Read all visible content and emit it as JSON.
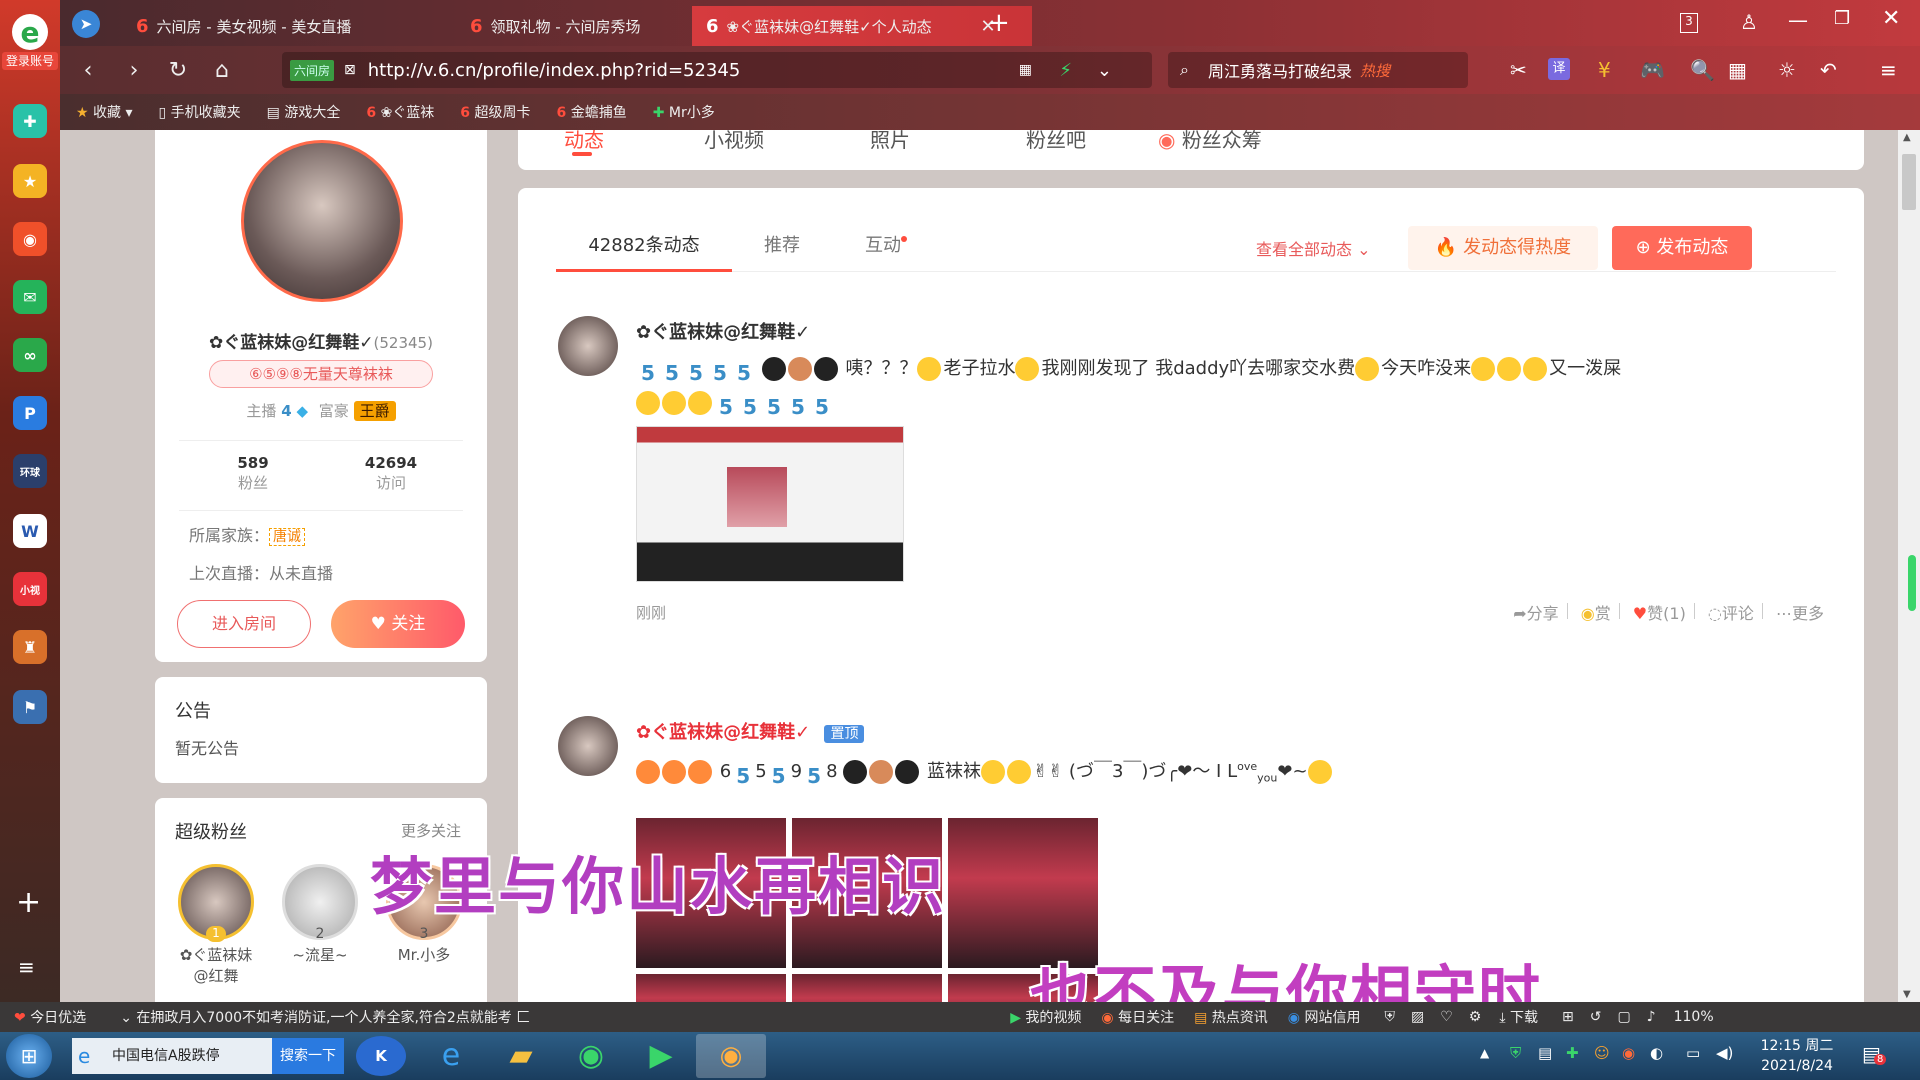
{
  "browser": {
    "login_label": "登录账号",
    "tabs": [
      {
        "label": "六间房 - 美女视频 - 美女直播"
      },
      {
        "label": "领取礼物 - 六间房秀场"
      },
      {
        "label": "❀ぐ蓝袜妹@红舞鞋✓个人动态"
      }
    ],
    "tab_count": "3",
    "url": "http://v.6.cn/profile/index.php?rid=52345",
    "site_badge": "六间房",
    "search_text": "周江勇落马打破纪录",
    "search_badge": "热搜",
    "translate_label": "译",
    "bookmarks": [
      "收藏",
      "手机收藏夹",
      "游戏大全",
      "❀ぐ蓝袜",
      "超级周卡",
      "金蟾捕鱼",
      "Mr小多"
    ]
  },
  "profile": {
    "name": "✿ぐ蓝袜妹@红舞鞋✓",
    "rid": "(52345)",
    "title_badge": "⑥⑤⑨⑧无量天尊袜袜",
    "host_label": "主播",
    "host_level": "4",
    "rich_label": "富豪",
    "rich_level": "王爵",
    "fans_count": "589",
    "fans_label": "粉丝",
    "visits_count": "42694",
    "visits_label": "访问",
    "family_label": "所属家族：",
    "family_value": "唐诚",
    "last_live": "上次直播：从未直播",
    "enter_room": "进入房间",
    "follow": "关注"
  },
  "notice": {
    "title": "公告",
    "body": "暂无公告"
  },
  "superfans": {
    "title": "超级粉丝",
    "more": "更多关注",
    "fans": [
      {
        "rank": "1",
        "name": "✿ぐ蓝袜妹@红舞"
      },
      {
        "rank": "2",
        "name": "~流星~"
      },
      {
        "rank": "3",
        "name": "Mr.小多"
      }
    ]
  },
  "top_tabs": [
    "动态",
    "小视频",
    "照片",
    "粉丝吧",
    "粉丝众筹"
  ],
  "feed": {
    "tabs": [
      "42882条动态",
      "推荐",
      "互动"
    ],
    "view_all": "查看全部动态",
    "boost": "发动态得热度",
    "publish": "发布动态",
    "posts": [
      {
        "author": "✿ぐ蓝袜妹@红舞鞋✓",
        "text_parts": [
          "咦？？？",
          "老子拉水",
          "我刚刚发现了 我daddy吖去哪家交水费",
          "今天咋没来",
          "又一泼屎"
        ],
        "time": "刚刚",
        "actions": {
          "share": "分享",
          "reward": "赏",
          "like": "赞(1)",
          "comment": "评论",
          "more": "更多"
        }
      },
      {
        "author": "✿ぐ蓝袜妹@红舞鞋✓",
        "pinned": "置顶",
        "text_parts": [
          "6",
          "5",
          "9",
          "8",
          "蓝袜袜",
          "(づ￣3￣)づ╭❤～ I L",
          "ove",
          "you",
          "❤~"
        ]
      }
    ]
  },
  "overlay": {
    "line1": "梦里与你山水再相识",
    "line2": "也不及与你相守时"
  },
  "statusbar": {
    "left": "今日优选",
    "news": "在拥政月入7000不如考消防证,一个人养全家,符合2点就能考",
    "my_video": "我的视频",
    "daily": "每日关注",
    "hot": "热点资讯",
    "web": "网站信用",
    "download": "下载",
    "zoom": "110%"
  },
  "taskbar": {
    "news": "中国电信A股跌停",
    "search": "搜索一下",
    "time": "12:15 周二",
    "date": "2021/8/24",
    "notif": "8"
  }
}
